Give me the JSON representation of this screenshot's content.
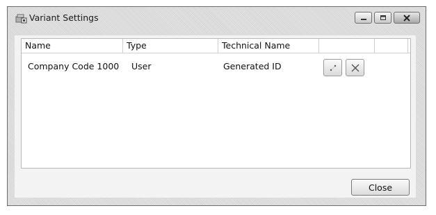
{
  "window": {
    "title": "Variant Settings",
    "app_icon": "variant-settings-icon",
    "controls": {
      "minimize_icon": "minimize-icon",
      "maximize_icon": "maximize-icon",
      "close_icon": "close-icon"
    }
  },
  "table": {
    "columns": [
      "Name",
      "Type",
      "Technical Name",
      "",
      ""
    ],
    "rows": [
      {
        "name": "Company Code 1000",
        "type": "User",
        "technical_name": "Generated ID",
        "actions": [
          "edit-icon",
          "delete-icon"
        ]
      }
    ]
  },
  "footer": {
    "close_label": "Close"
  },
  "colors": {
    "window_bg": "#dcdcdc",
    "content_bg": "#f3f3f3",
    "grid_border": "#b9b9b9",
    "close_button_red": "#c0392b"
  }
}
